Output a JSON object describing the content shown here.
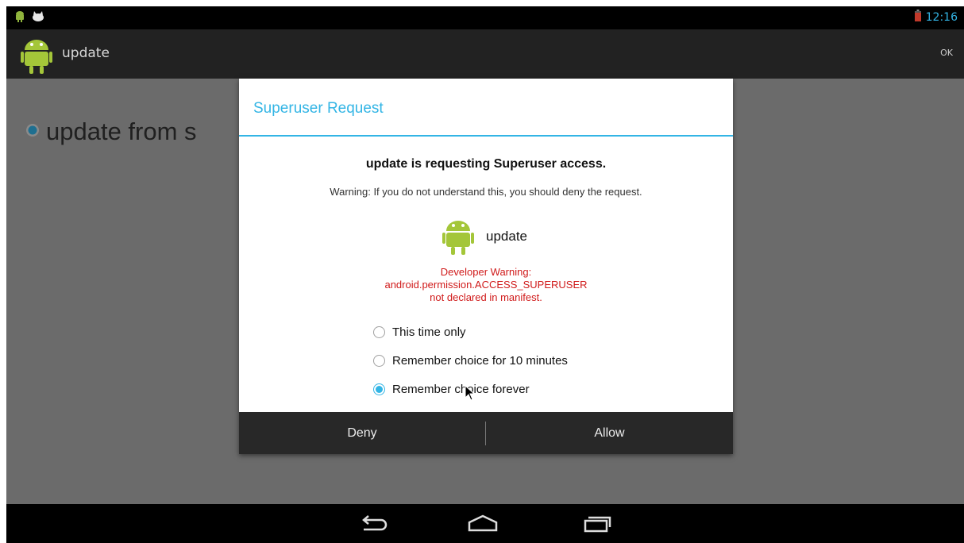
{
  "status_bar": {
    "time": "12:16",
    "left_icons": [
      "android-notification-icon",
      "cat-notification-icon"
    ],
    "battery_icon": "battery-low-icon"
  },
  "action_bar": {
    "app_name": "update",
    "ok_label": "OK",
    "app_icon": "android-icon"
  },
  "background": {
    "item_label": "update from s"
  },
  "dialog": {
    "title": "Superuser Request",
    "heading": "update is requesting Superuser access.",
    "warning": "Warning: If you do not understand this, you should deny the request.",
    "app_name": "update",
    "dev_warning_line1": "Developer Warning:",
    "dev_warning_line2": "android.permission.ACCESS_SUPERUSER",
    "dev_warning_line3": "not declared in manifest.",
    "options": [
      {
        "label": "This time only",
        "checked": false
      },
      {
        "label": "Remember choice for 10 minutes",
        "checked": false
      },
      {
        "label": "Remember choice forever",
        "checked": true
      }
    ],
    "deny_label": "Deny",
    "allow_label": "Allow"
  },
  "nav_bar": {
    "icons": [
      "back-icon",
      "home-icon",
      "recents-icon"
    ]
  },
  "colors": {
    "accent": "#33b5e5",
    "warning_red": "#d01a1a",
    "dim_background": "#6b6b6b"
  }
}
